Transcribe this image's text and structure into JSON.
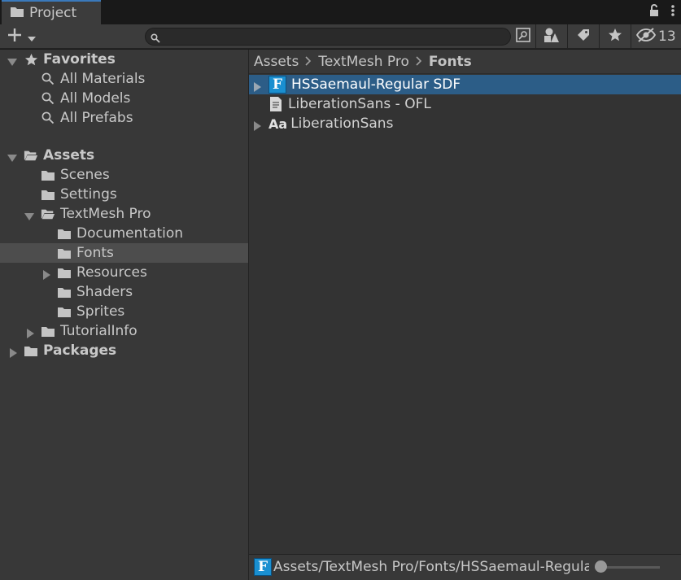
{
  "tab": {
    "label": "Project"
  },
  "toolbar": {
    "search_placeholder": "",
    "hidden_count": "13"
  },
  "tree": {
    "favorites_label": "Favorites",
    "favorites": [
      "All Materials",
      "All Models",
      "All Prefabs"
    ],
    "assets_label": "Assets",
    "assets_children": [
      "Scenes",
      "Settings"
    ],
    "textmesh_label": "TextMesh Pro",
    "textmesh_children": [
      "Documentation",
      "Fonts",
      "Resources",
      "Shaders",
      "Sprites"
    ],
    "tutorial_label": "TutorialInfo",
    "packages_label": "Packages"
  },
  "breadcrumb": [
    "Assets",
    "TextMesh Pro",
    "Fonts"
  ],
  "files": [
    "HSSaemaul-Regular SDF",
    "LiberationSans - OFL",
    "LiberationSans"
  ],
  "font_asset_glyph": "F",
  "font_file_glyph": "Aa",
  "status": {
    "path": "Assets/TextMesh Pro/Fonts/HSSaemaul-Regular SDF.asset"
  },
  "colors": {
    "accent": "#3a79bb",
    "selection": "#2c5d87",
    "font_asset": "#1a8fd0"
  }
}
